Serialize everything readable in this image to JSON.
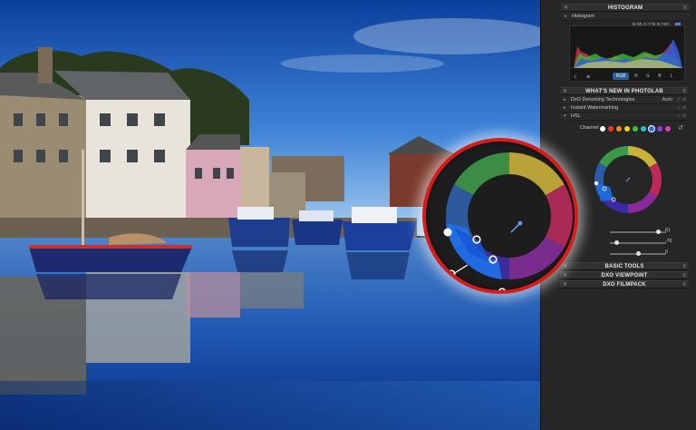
{
  "panel": {
    "histogram": {
      "header": "HISTOGRAM",
      "sub_label": "Histogram",
      "rgb_readout": "R:95 G:126 B:190",
      "swatch_color": "#4f86c6",
      "channels": [
        "RGB",
        "R",
        "G",
        "B",
        "L"
      ]
    },
    "whats_new": {
      "header": "WHAT'S NEW IN PHOTOLAB",
      "items": [
        {
          "label": "DxO Denoising Technologies",
          "value": "Auto"
        },
        {
          "label": "Instant Watermarking",
          "value": ""
        },
        {
          "label": "HSL",
          "value": ""
        }
      ],
      "channel_label": "Channel",
      "channel_dots": [
        "#ffffff",
        "#e8382f",
        "#f28b1d",
        "#f2d21d",
        "#3fbf3f",
        "#26c1c9",
        "#2e69e6",
        "#8a3fe0",
        "#e03fb8"
      ],
      "sliders": [
        {
          "value": "61",
          "fraction": 0.86
        },
        {
          "value": "-76",
          "fraction": 0.12
        },
        {
          "value": "0",
          "fraction": 0.5
        }
      ]
    },
    "basic_tools": {
      "header": "BASIC TOOLS"
    },
    "viewpoint": {
      "header": "DXO VIEWPOINT"
    },
    "filmpack": {
      "header": "DXO FILMPACK"
    },
    "close_glyph": "✕",
    "menu_glyph": "≡",
    "tri_glyph": "▸",
    "star_glyph": "☆",
    "reset_glyph": "↺",
    "icons": [
      "moon-icon",
      "sun-icon",
      "eyedropper-icon",
      "reset-icon",
      "star-icon"
    ]
  }
}
